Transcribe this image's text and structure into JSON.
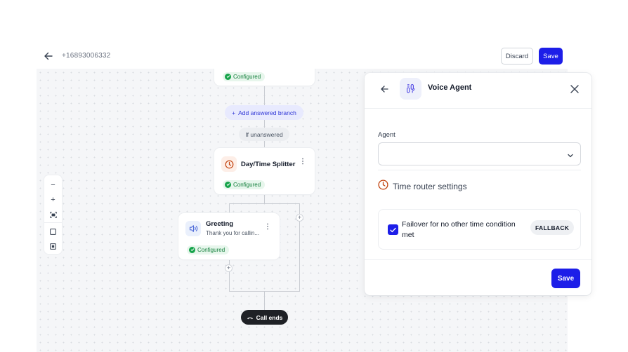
{
  "header": {
    "phone_number": "+16893006332",
    "discard_label": "Discard",
    "save_label": "Save"
  },
  "flow": {
    "top_node": {
      "status": "Configured"
    },
    "add_branch_label": "Add answered branch",
    "add_branch_prefix": "+",
    "if_unanswered_label": "If unanswered",
    "splitter_node": {
      "title": "Day/Time Splitter",
      "status": "Configured",
      "icon": "clock-icon"
    },
    "greeting_node": {
      "title": "Greeting",
      "subtitle": "Thank you for callin...",
      "status": "Configured",
      "icon": "speaker-icon"
    },
    "call_ends_label": "Call ends",
    "add_step_glyph": "+"
  },
  "zoom_controls": {
    "zoom_out": "−",
    "zoom_in": "+"
  },
  "side_panel": {
    "title": "Voice Agent",
    "agent_label": "Agent",
    "agent_value": "",
    "section_title": "Time router settings",
    "failover_label": "Failover for no other time condition met",
    "failover_checked": true,
    "fallback_badge": "FALLBACK",
    "save_label": "Save"
  },
  "colors": {
    "primary": "#1d1ee8",
    "configured_bg": "#e7f6ec",
    "configured_text": "#15803d",
    "clock_orange": "#c2410c",
    "call_ends_bg": "#1f2126"
  }
}
